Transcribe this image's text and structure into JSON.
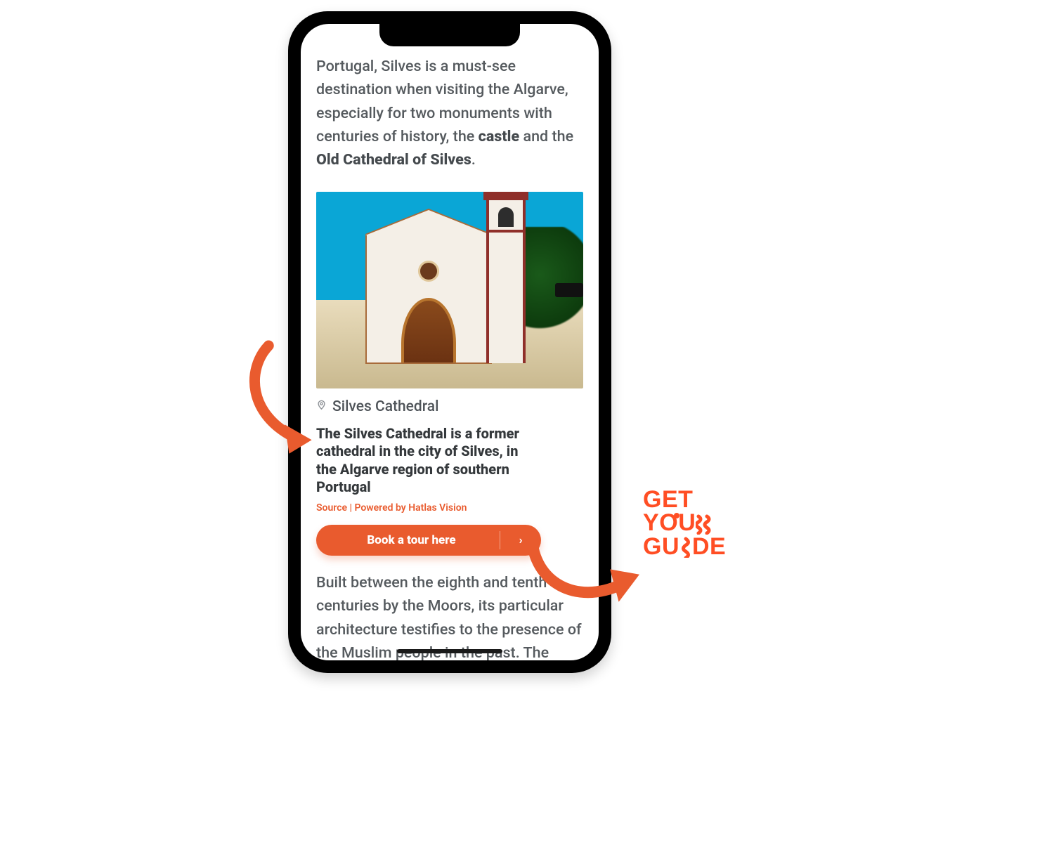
{
  "article": {
    "intro_prefix": "Portugal, Silves is a must-see destination when visiting the Algarve, especially for two monuments with centuries of history, the ",
    "intro_bold1": "castle",
    "intro_mid": " and the ",
    "intro_bold2": "Old Cathedral of Silves",
    "intro_suffix": ".",
    "image_caption": "Silves Cathedral",
    "subheading": "The Silves Cathedral is a former cathedral in the city of Silves, in the Algarve region of southern Portugal",
    "source_line": "Source | Powered by Hatlas Vision",
    "cta_label": "Book a tour here",
    "body2": "Built between the eighth and tenth centuries by the Moors, its particular architecture testifies to the presence of the Muslim people in the past. The"
  },
  "brand": {
    "line1": "GET",
    "line2a": "Y",
    "line2b": "U",
    "line2c": "R",
    "line3a": "GU",
    "line3b": "DE"
  },
  "colors": {
    "accent": "#e95b2e",
    "brand": "#ff4e24",
    "text": "#555a5e"
  }
}
